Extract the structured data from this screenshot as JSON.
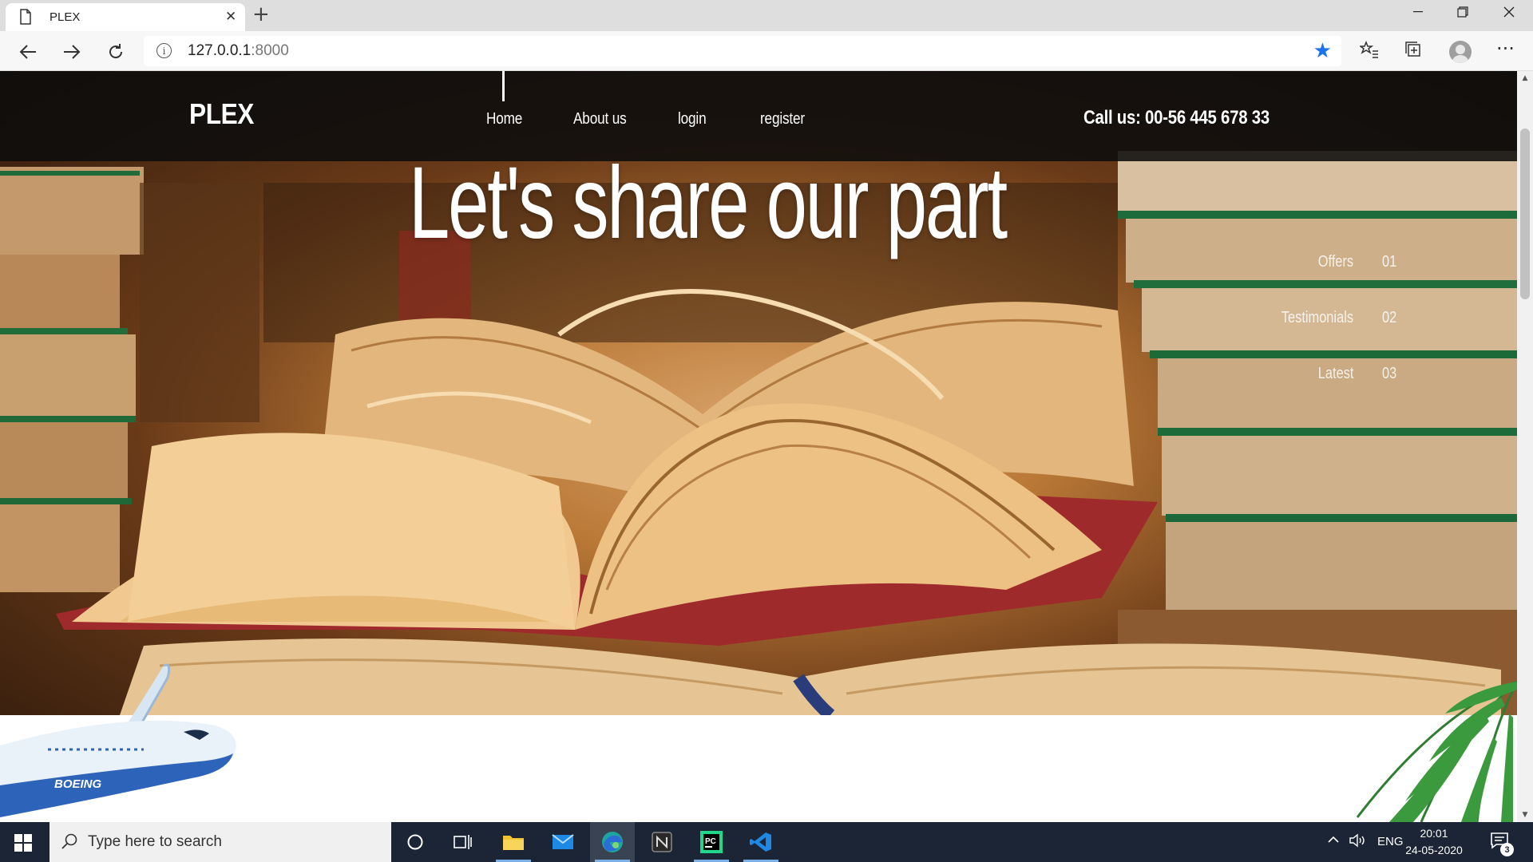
{
  "browser": {
    "tab_title": "PLEX",
    "tab_icon": "page-icon",
    "close_tab": "✕",
    "new_tab": "+",
    "url_host": "127.0.0.1",
    "url_port": ":8000",
    "bookmark_color": "#1a73e8"
  },
  "site": {
    "logo": "PLEX",
    "menu": [
      "Home",
      "About us",
      "login",
      "register"
    ],
    "call_us": "Call us: 00-56 445 678 33",
    "hero_title": "Let's share our part",
    "side_nav": [
      {
        "label": "Offers",
        "num": "01"
      },
      {
        "label": "Testimonials",
        "num": "02"
      },
      {
        "label": "Latest",
        "num": "03"
      }
    ],
    "plane_text": "BOEING"
  },
  "taskbar": {
    "search_placeholder": "Type here to search",
    "lang": "ENG",
    "time": "20:01",
    "date": "24-05-2020",
    "notifications": "3",
    "accent": "#7ab0e6",
    "background": "#1b2535"
  }
}
